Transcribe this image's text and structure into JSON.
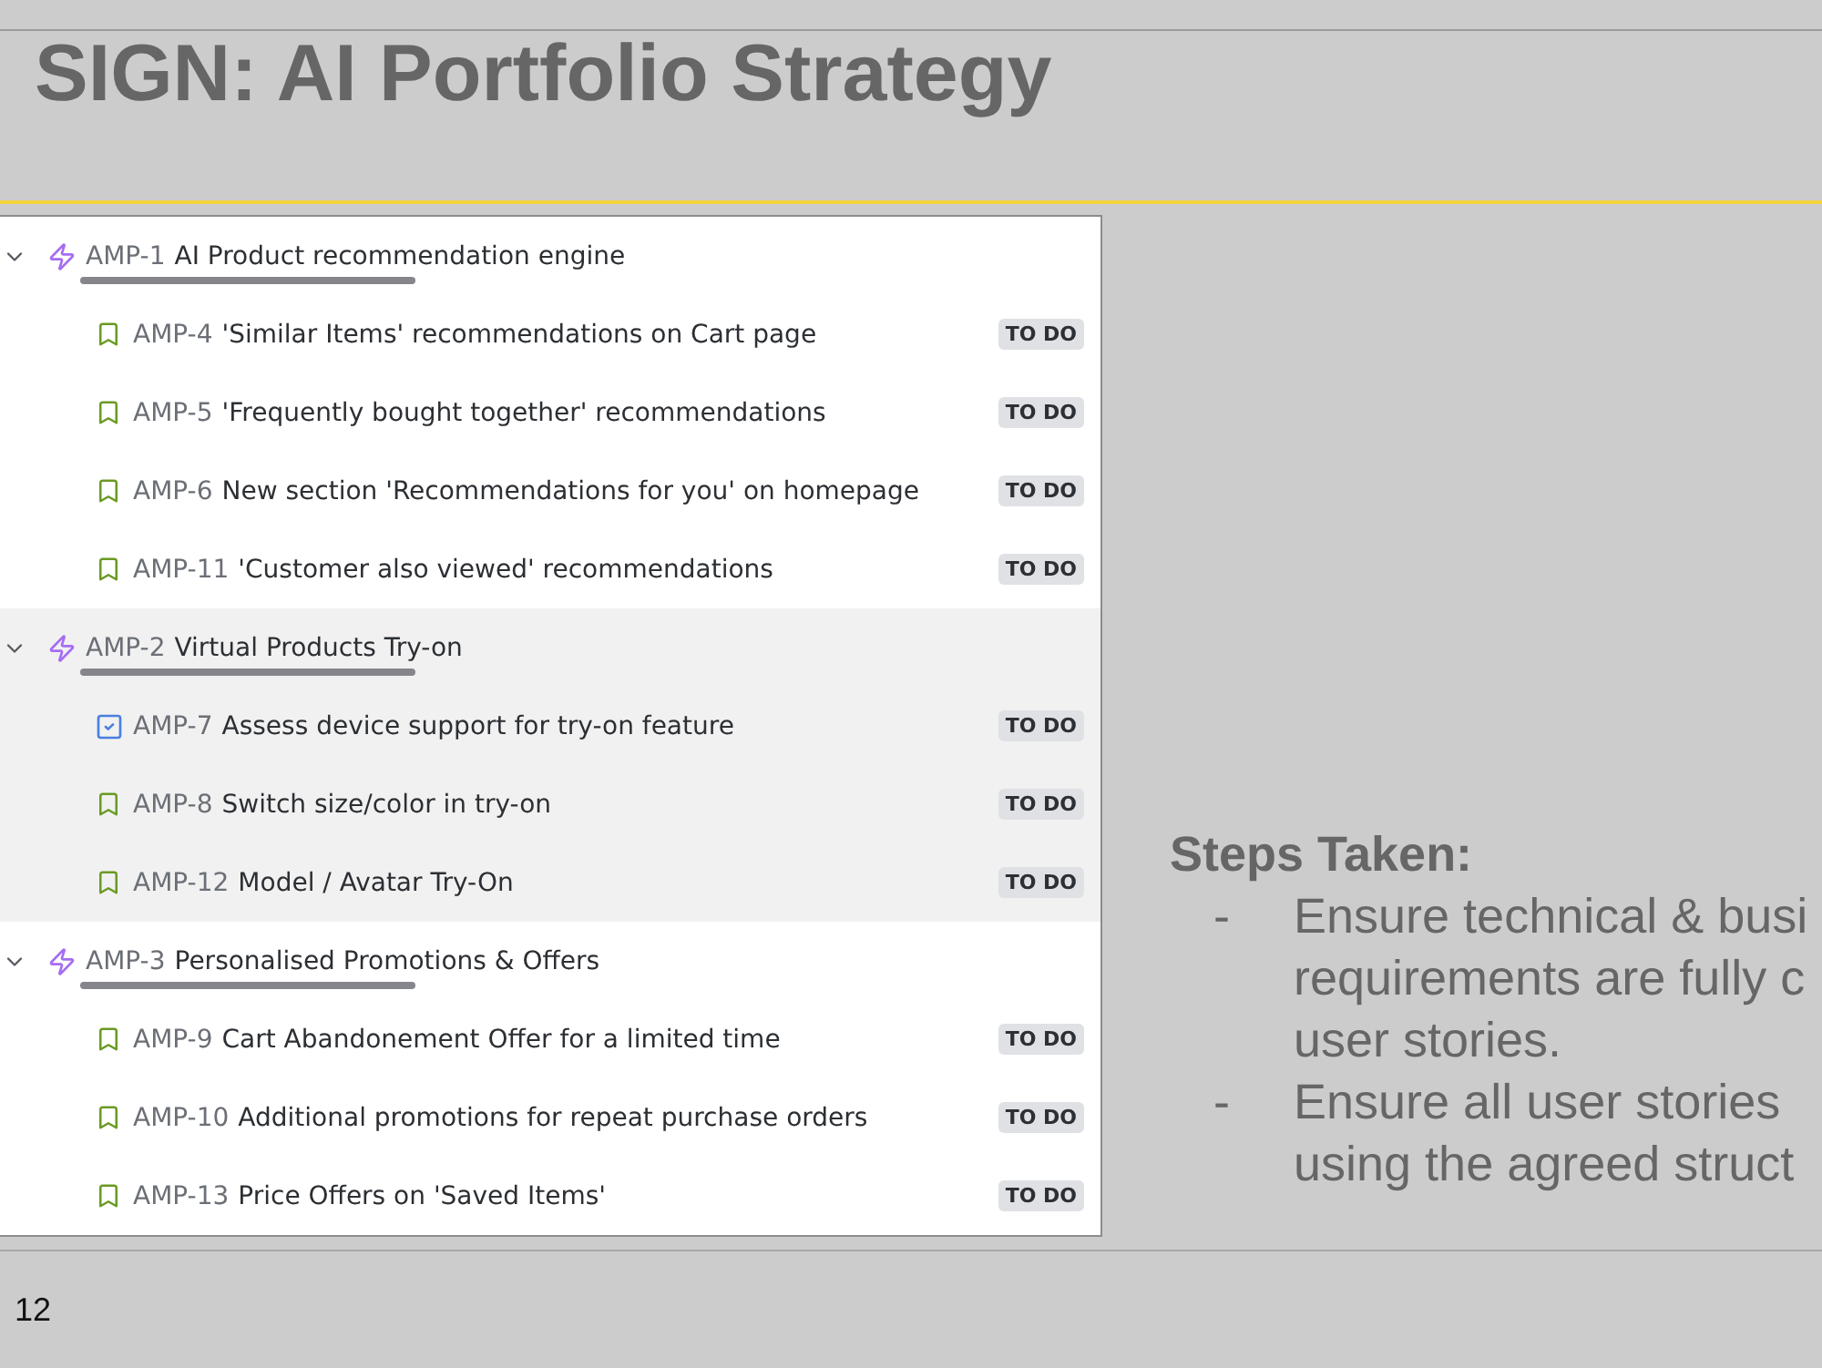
{
  "slide": {
    "title": "SIGN: AI Portfolio Strategy",
    "page_number": "12"
  },
  "issue_tree": {
    "epics": [
      {
        "key": "AMP-1",
        "summary": "AI Product recommendation engine",
        "expanded": true,
        "highlighted": false,
        "children": [
          {
            "kind": "story",
            "key": "AMP-4",
            "summary": "'Similar Items' recommendations on Cart page",
            "status": "TO DO"
          },
          {
            "kind": "story",
            "key": "AMP-5",
            "summary": "'Frequently bought together' recommendations",
            "status": "TO DO"
          },
          {
            "kind": "story",
            "key": "AMP-6",
            "summary": "New section 'Recommendations for you' on homepage",
            "status": "TO DO"
          },
          {
            "kind": "story",
            "key": "AMP-11",
            "summary": "'Customer also viewed' recommendations",
            "status": "TO DO"
          }
        ]
      },
      {
        "key": "AMP-2",
        "summary": "Virtual Products Try-on",
        "expanded": true,
        "highlighted": true,
        "children": [
          {
            "kind": "task",
            "key": "AMP-7",
            "summary": "Assess device support for try-on feature",
            "status": "TO DO"
          },
          {
            "kind": "story",
            "key": "AMP-8",
            "summary": "Switch size/color in try-on",
            "status": "TO DO"
          },
          {
            "kind": "story",
            "key": "AMP-12",
            "summary": "Model / Avatar Try-On",
            "status": "TO DO"
          }
        ]
      },
      {
        "key": "AMP-3",
        "summary": "Personalised Promotions & Offers",
        "expanded": true,
        "highlighted": false,
        "children": [
          {
            "kind": "story",
            "key": "AMP-9",
            "summary": "Cart Abandonement Offer for a limited time",
            "status": "TO DO"
          },
          {
            "kind": "story",
            "key": "AMP-10",
            "summary": "Additional promotions for repeat purchase orders",
            "status": "TO DO"
          },
          {
            "kind": "story",
            "key": "AMP-13",
            "summary": "Price Offers on 'Saved Items'",
            "status": "TO DO"
          }
        ]
      }
    ]
  },
  "notes": {
    "heading": "Steps Taken:",
    "bullets": [
      {
        "marker": "-",
        "lines": [
          "Ensure technical & busi",
          "requirements are fully c",
          "user stories."
        ]
      },
      {
        "marker": "-",
        "lines": [
          "Ensure all user stories",
          "using the agreed struct"
        ]
      }
    ]
  }
}
